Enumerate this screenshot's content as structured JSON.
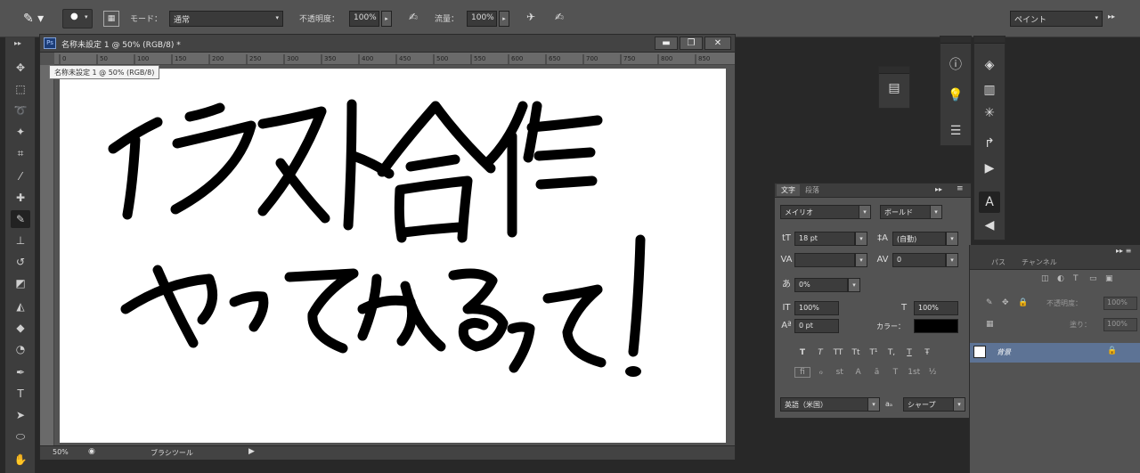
{
  "options_bar": {
    "mode_label": "モード：",
    "mode_value": "通常",
    "opacity_label": "不透明度：",
    "opacity_value": "100%",
    "flow_label": "流量：",
    "flow_value": "100%",
    "workspace_value": "ペイント"
  },
  "document": {
    "title": "名称未設定 1 @ 50% (RGB/8) *",
    "tooltip": "名称未設定 1 @ 50% (RGB/8)",
    "zoom": "50%",
    "status_tool": "ブラシツール",
    "ruler_ticks": [
      "0",
      "50",
      "100",
      "150",
      "200",
      "250",
      "300",
      "350",
      "400",
      "450",
      "500",
      "550",
      "600",
      "650",
      "700",
      "750",
      "800",
      "850"
    ]
  },
  "artwork": {
    "line1": "イラスト合作",
    "line2": "やってみるって！"
  },
  "character_panel": {
    "tab_character": "文字",
    "tab_paragraph": "段落",
    "font_family": "メイリオ",
    "font_style": "ボールド",
    "font_size": "18 pt",
    "leading": "(自動)",
    "kerning": "",
    "tracking": "0",
    "tsume": "0%",
    "vertical_scale": "100%",
    "horizontal_scale": "100%",
    "baseline_shift": "0 pt",
    "color_label": "カラー：",
    "color_value": "#000000",
    "language": "英語（米国）",
    "aa_label": "aₐ",
    "antialias": "シャープ",
    "style_buttons": [
      "T",
      "T",
      "TT",
      "Tt",
      "T¹",
      "T,",
      "T",
      "Ŧ"
    ]
  },
  "layers_panel": {
    "tab_paths": "パス",
    "tab_channels": "チャンネル",
    "opacity_label": "不透明度：",
    "opacity_value": "100%",
    "fill_label": "塗り：",
    "fill_value": "100%",
    "layer_name": "背景"
  },
  "colors": {
    "ui_dark": "#282828",
    "ui_mid": "#535353",
    "canvas": "#ffffff",
    "ink": "#000000",
    "layer_selected": "#5d7395"
  }
}
